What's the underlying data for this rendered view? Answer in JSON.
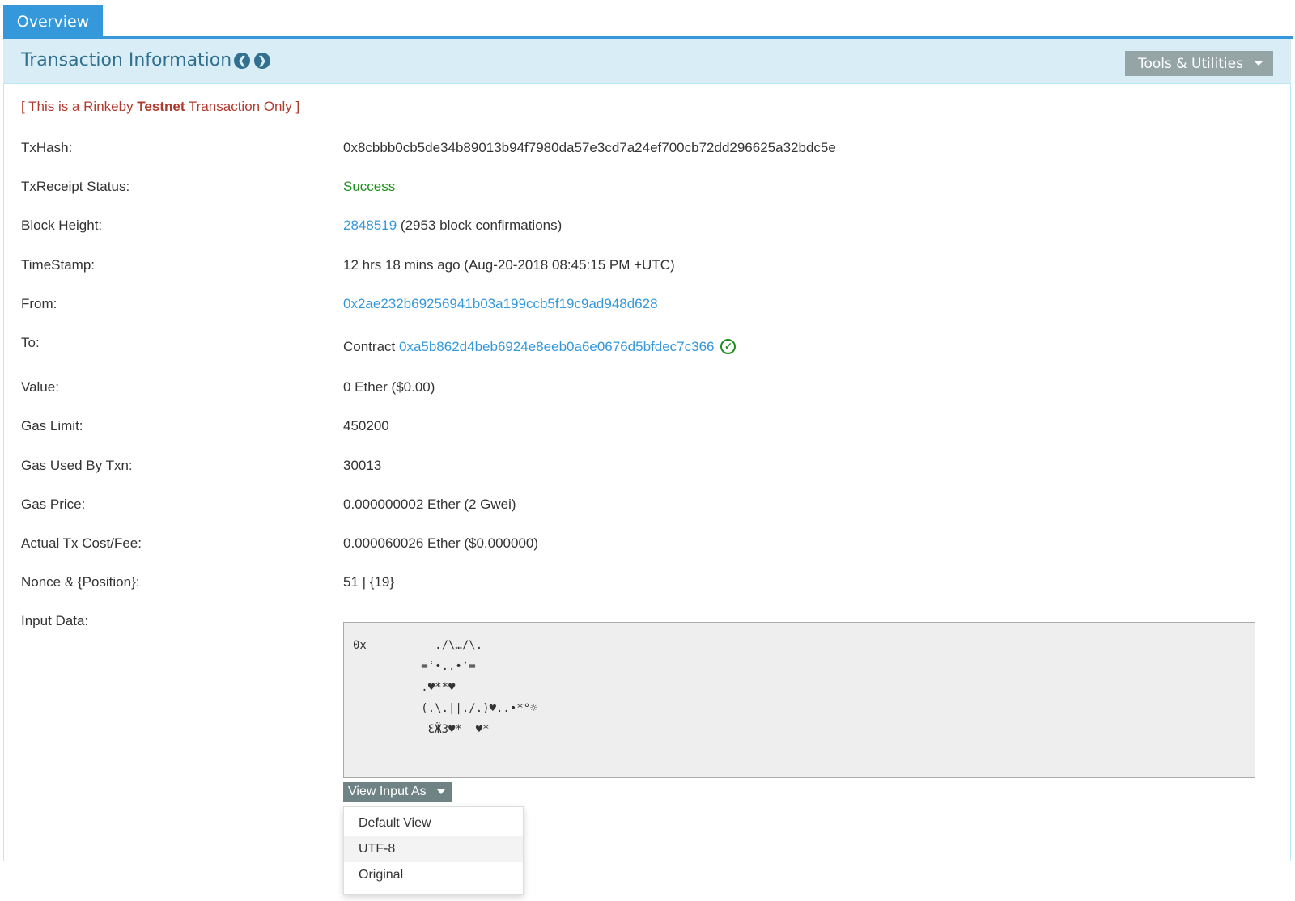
{
  "tab": {
    "label": "Overview"
  },
  "header": {
    "title": "Transaction Information",
    "tools_label": "Tools & Utilities"
  },
  "notice": {
    "prefix": "[ This is a Rinkeby ",
    "bold": "Testnet",
    "suffix": " Transaction Only ]"
  },
  "fields": {
    "txhash": {
      "label": "TxHash:",
      "value": "0x8cbbb0cb5de34b89013b94f7980da57e3cd7a24ef700cb72dd296625a32bdc5e"
    },
    "status": {
      "label": "TxReceipt Status:",
      "value": "Success"
    },
    "block": {
      "label": "Block Height:",
      "link": "2848519",
      "extra": " (2953 block confirmations)"
    },
    "timestamp": {
      "label": "TimeStamp:",
      "value": "12 hrs 18 mins ago (Aug-20-2018 08:45:15 PM +UTC)"
    },
    "from": {
      "label": "From:",
      "link": "0x2ae232b69256941b03a199ccb5f19c9ad948d628"
    },
    "to": {
      "label": "To:",
      "prefix": "Contract ",
      "link": "0xa5b862d4beb6924e8eeb0a6e0676d5bfdec7c366"
    },
    "value": {
      "label": "Value:",
      "value": "0 Ether ($0.00)"
    },
    "gas_limit": {
      "label": "Gas Limit:",
      "value": "450200"
    },
    "gas_used": {
      "label": "Gas Used By Txn:",
      "value": "30013"
    },
    "gas_price": {
      "label": "Gas Price:",
      "value": "0.000000002 Ether (2 Gwei)"
    },
    "fee": {
      "label": "Actual Tx Cost/Fee:",
      "value": "0.000060026 Ether ($0.000000)"
    },
    "nonce": {
      "label": "Nonce & {Position}:",
      "value": "51 | {19}"
    },
    "input": {
      "label": "Input Data:",
      "value": "0x          ./\\…/\\.\n          =ʿ•..•ʾ=\n          .♥**♥\n          (.\\.||./.)♥..•*°☼\n           ƐӜЗ♥*  ♥*"
    }
  },
  "view_input": {
    "label": "View Input As",
    "options": [
      "Default View",
      "UTF-8",
      "Original"
    ]
  }
}
